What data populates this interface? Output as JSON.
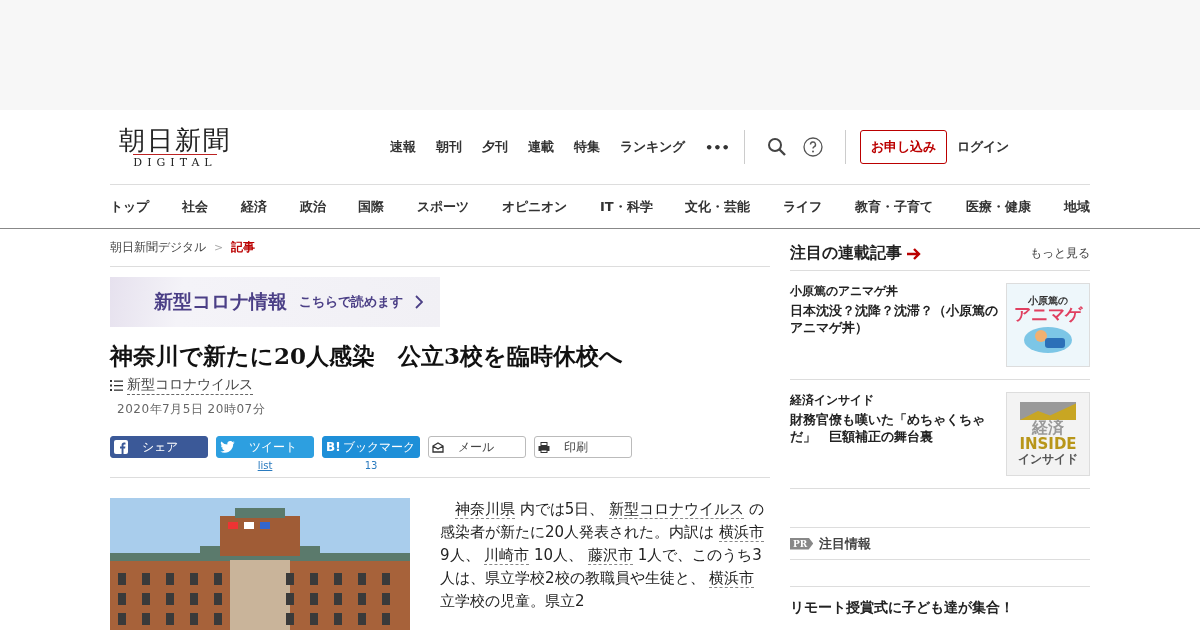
{
  "logo": {
    "title": "朝日新聞",
    "subtitle": "DIGITAL"
  },
  "top_nav": [
    "速報",
    "朝刊",
    "夕刊",
    "連載",
    "特集",
    "ランキング"
  ],
  "more_icon": "•••",
  "subscribe_button": "お申し込み",
  "login_link": "ログイン",
  "category_nav": [
    "トップ",
    "社会",
    "経済",
    "政治",
    "国際",
    "スポーツ",
    "オピニオン",
    "IT・科学",
    "文化・芸能",
    "ライフ",
    "教育・子育て",
    "医療・健康",
    "地域"
  ],
  "breadcrumb": [
    {
      "label": "朝日新聞デジタル",
      "current": false
    },
    {
      "label": "記事",
      "current": true
    }
  ],
  "breadcrumb_separator": ">",
  "banner": {
    "title": "新型コロナ情報",
    "link": "こちらで読めます"
  },
  "article": {
    "title": "神奈川で新たに20人感染　公立3校を臨時休校へ",
    "topic": "新型コロナウイルス",
    "date": "2020年7月5日 20時07分",
    "share_buttons": [
      {
        "kind": "facebook",
        "label": "シェア"
      },
      {
        "kind": "twitter",
        "label": "ツイート",
        "count": "list"
      },
      {
        "kind": "hatena",
        "label": "ブックマーク",
        "icon_text": "B!",
        "count": "13"
      },
      {
        "kind": "mail",
        "label": "メール"
      },
      {
        "kind": "print",
        "label": "印刷"
      }
    ],
    "body": [
      {
        "text": "神奈川県",
        "link": true
      },
      {
        "text": " 内では5日、 ",
        "link": false
      },
      {
        "text": "新型コロナウイルス",
        "link": true
      },
      {
        "text": " の感染者が新たに20人発表された。内訳は ",
        "link": false
      },
      {
        "text": "横浜市",
        "link": true
      },
      {
        "text": " 9人、 ",
        "link": false
      },
      {
        "text": "川崎市",
        "link": true
      },
      {
        "text": " 10人、 ",
        "link": false
      },
      {
        "text": "藤沢市",
        "link": true
      },
      {
        "text": " 1人で、このうち3人は、県立学校2校の教職員や生徒と、 ",
        "link": false
      },
      {
        "text": "横浜市",
        "link": true
      },
      {
        "text": " 立学校の児童。県立2",
        "link": false
      }
    ]
  },
  "sidebar": {
    "heading": "注目の連載記事",
    "more_link": "もっと見る",
    "items": [
      {
        "series": "小原篤のアニマゲ丼",
        "title": "日本沈没？沈降？沈滞？（小原篤のアニマゲ丼）",
        "kind": "anime",
        "thumb_texts": [
          "小原篤の",
          "アニマゲ"
        ]
      },
      {
        "series": "経済インサイド",
        "title": "財務官僚も嘆いた「めちゃくちゃだ」　巨額補正の舞台裏",
        "kind": "economy",
        "thumb_texts": [
          "経済",
          "INSIDE",
          "インサイド"
        ]
      }
    ],
    "pr_badge": "PR",
    "pr_heading": "注目情報",
    "pr_title": "リモート授賞式に子ども達が集合！"
  }
}
